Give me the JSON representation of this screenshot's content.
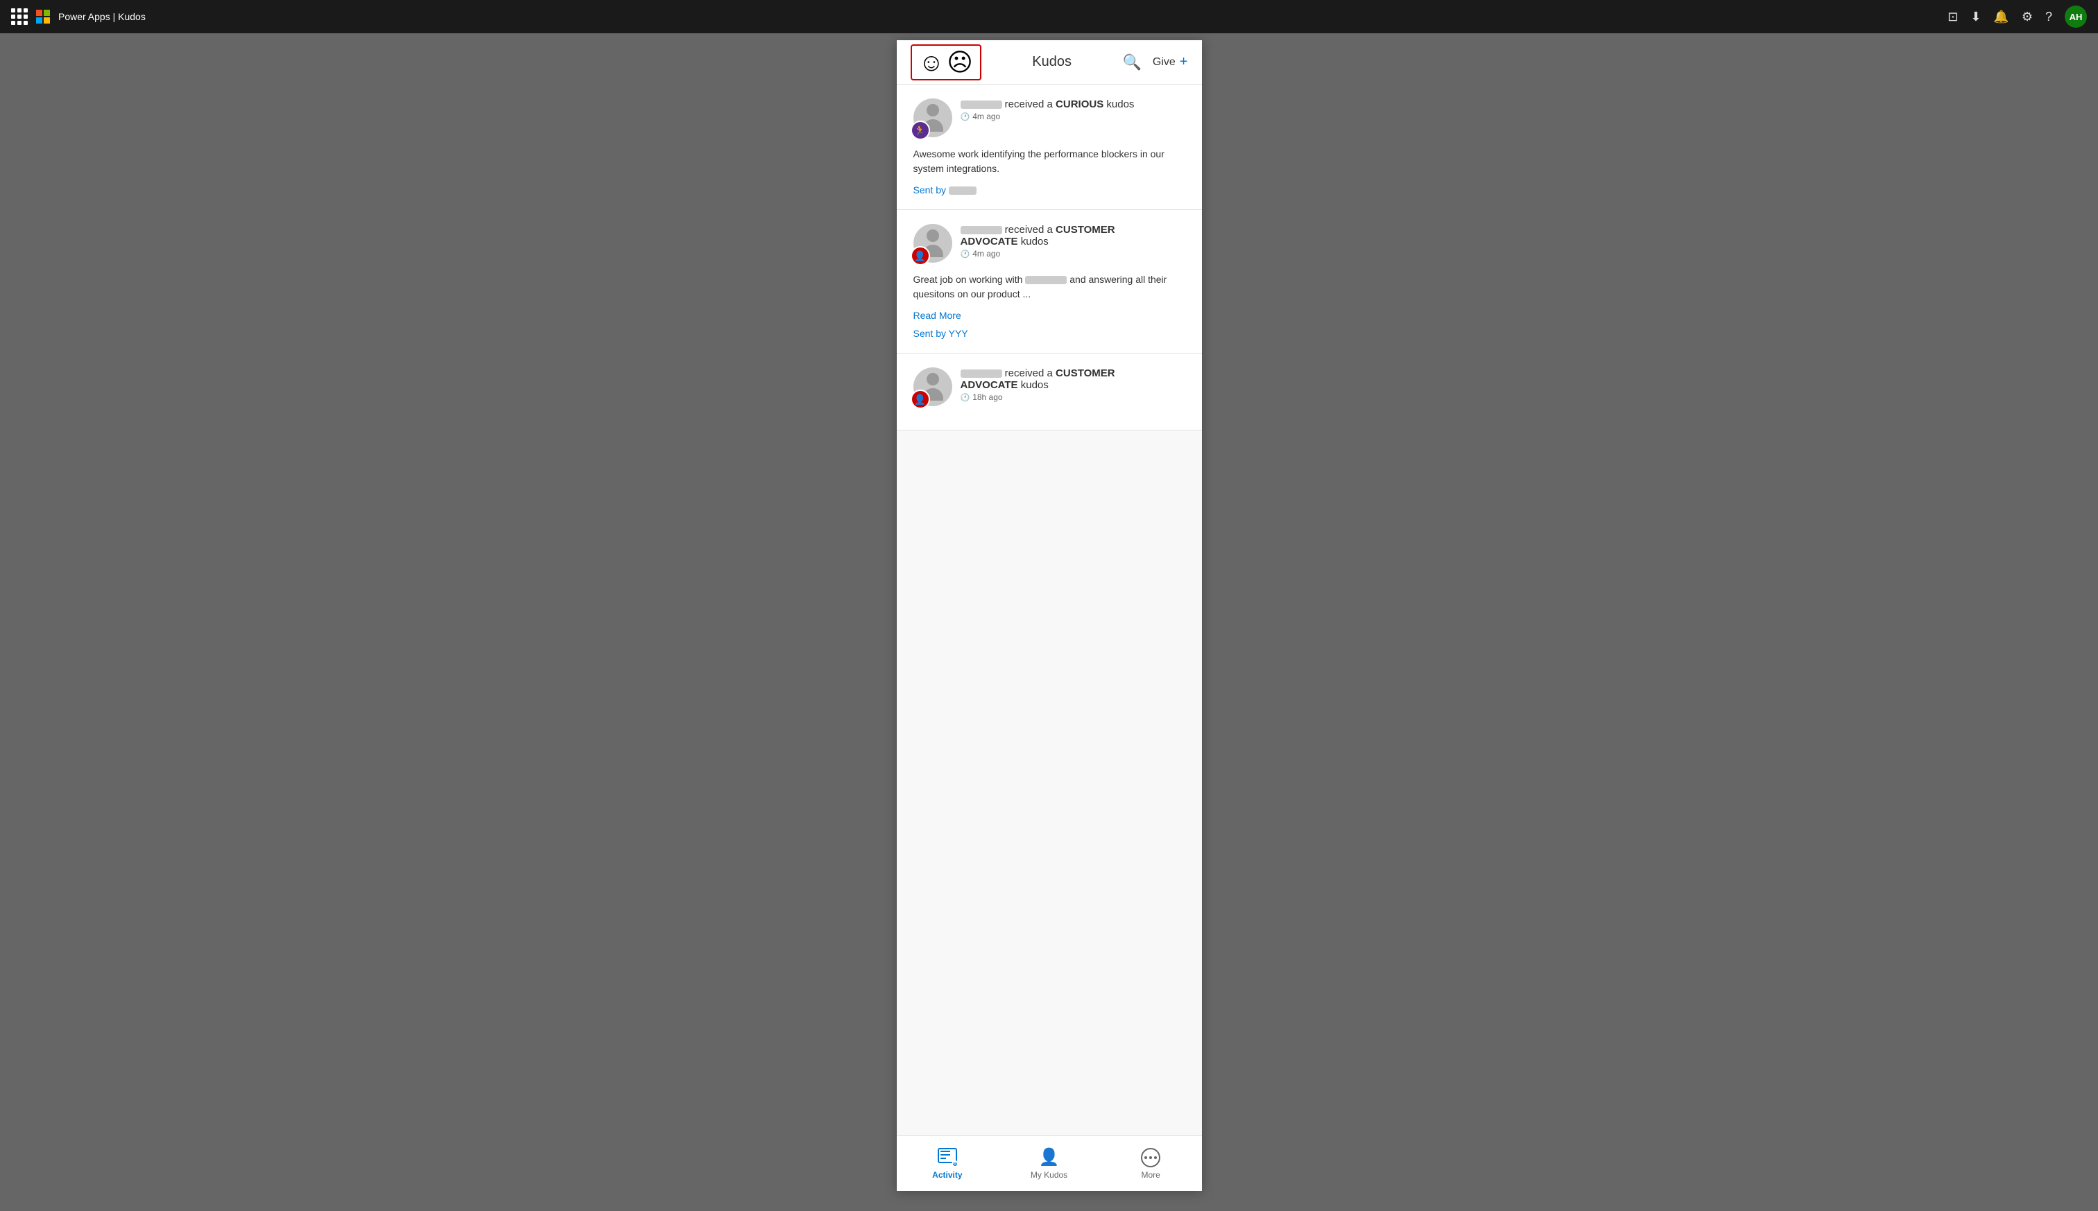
{
  "topbar": {
    "app_name": "Power Apps | Kudos",
    "avatar_initials": "AH"
  },
  "panel": {
    "header": {
      "title": "Kudos",
      "give_label": "Give",
      "plus_symbol": "+"
    },
    "feed": {
      "cards": [
        {
          "id": 1,
          "recipient_prefix": "received a",
          "kudos_type": "CURIOUS",
          "kudos_suffix": "kudos",
          "time": "4m ago",
          "badge_color": "purple",
          "badge_emoji": "🏃",
          "body": "Awesome work identifying the performance blockers in our system integrations.",
          "sent_by_label": "Sent by",
          "read_more": null
        },
        {
          "id": 2,
          "recipient_prefix": "received a",
          "kudos_type": "CUSTOMER ADVOCATE",
          "kudos_suffix": "kudos",
          "time": "4m ago",
          "badge_color": "red",
          "badge_emoji": "👤",
          "body": "Great job on working with",
          "body_suffix": "and answering all their quesitons on our product ...",
          "sent_by_label": "Sent by YYY",
          "read_more": "Read More"
        },
        {
          "id": 3,
          "recipient_prefix": "received a",
          "kudos_type": "CUSTOMER ADVOCATE",
          "kudos_suffix": "kudos",
          "time": "18h ago",
          "badge_color": "red",
          "badge_emoji": "👤",
          "body": "",
          "sent_by_label": null,
          "read_more": null
        }
      ]
    },
    "bottom_nav": {
      "items": [
        {
          "id": "activity",
          "label": "Activity",
          "active": true
        },
        {
          "id": "my-kudos",
          "label": "My Kudos",
          "active": false
        },
        {
          "id": "more",
          "label": "More",
          "active": false
        }
      ]
    }
  }
}
